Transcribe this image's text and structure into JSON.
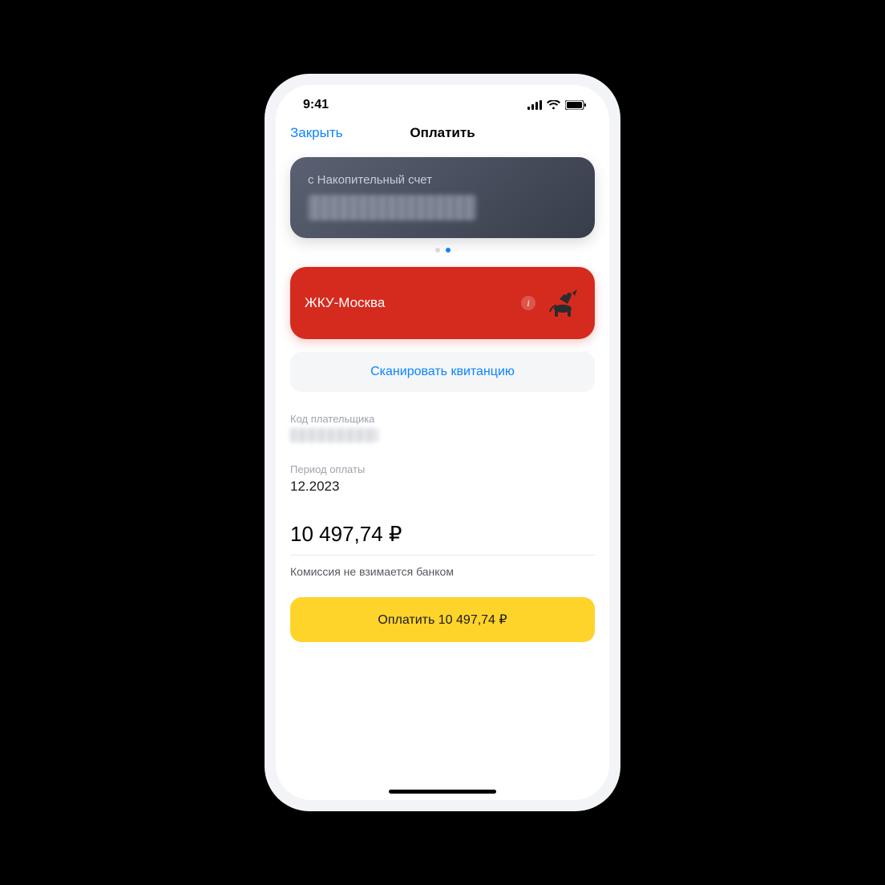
{
  "status": {
    "time": "9:41"
  },
  "nav": {
    "close_label": "Закрыть",
    "title": "Оплатить"
  },
  "account": {
    "prefix_label": "с Накопительный счет"
  },
  "payee": {
    "name": "ЖКУ-Москва"
  },
  "scan": {
    "label": "Сканировать квитанцию"
  },
  "fields": {
    "payer_code_label": "Код плательщика",
    "period_label": "Период оплаты",
    "period_value": "12.2023"
  },
  "amount": {
    "display": "10 497,74 ₽"
  },
  "commission": {
    "note": "Комиссия не взимается банком"
  },
  "pay_button": {
    "label": "Оплатить 10 497,74 ₽"
  }
}
